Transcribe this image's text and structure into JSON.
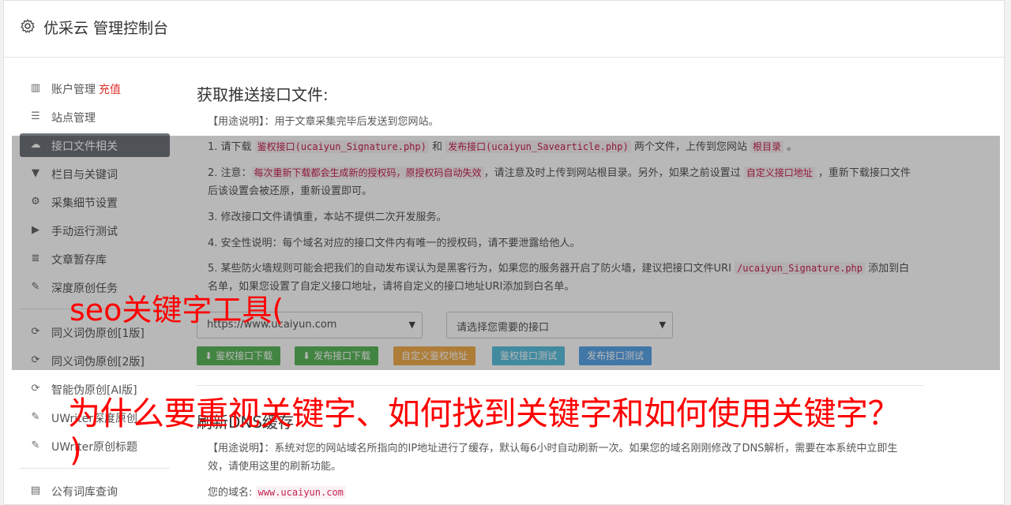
{
  "header": {
    "title": "优采云 管理控制台",
    "icon": "gear-icon"
  },
  "sidebar": {
    "items": [
      {
        "label": "账户管理",
        "extra": "充值",
        "icon": "bar-chart-icon",
        "glyph": "▥"
      },
      {
        "label": "站点管理",
        "icon": "server-icon",
        "glyph": "☰"
      },
      {
        "label": "接口文件相关",
        "icon": "cloud-upload-icon",
        "glyph": "☁",
        "active": true
      },
      {
        "label": "栏目与关键词",
        "icon": "filter-icon",
        "glyph": "▼"
      },
      {
        "label": "采集细节设置",
        "icon": "cogs-icon",
        "glyph": "⚙"
      },
      {
        "label": "手动运行测试",
        "icon": "play-circle-icon",
        "glyph": "▶"
      },
      {
        "label": "文章暂存库",
        "icon": "database-icon",
        "glyph": "≣"
      },
      {
        "label": "深度原创任务",
        "icon": "edit-icon",
        "glyph": "✎"
      },
      {
        "label": "同义词伪原创[1版]",
        "icon": "refresh-icon",
        "glyph": "⟳"
      },
      {
        "label": "同义词伪原创[2版]",
        "icon": "refresh-icon",
        "glyph": "⟳"
      },
      {
        "label": "智能伪原创[AI版]",
        "icon": "refresh-icon",
        "glyph": "⟳"
      },
      {
        "label": "UWriter深度原创",
        "icon": "edit-icon",
        "glyph": "✎"
      },
      {
        "label": "UWriter原创标题",
        "icon": "edit-icon",
        "glyph": "✎"
      },
      {
        "label": "公有词库查询",
        "icon": "book-icon",
        "glyph": "▤"
      }
    ]
  },
  "section1": {
    "title": "获取推送接口文件:",
    "usage": "【用途说明】：用于文章采集完毕后发送到您网站。",
    "p1": {
      "a": "1. 请下载 ",
      "c1": "鉴权接口(ucaiyun_Signature.php)",
      "b": " 和 ",
      "c2": "发布接口(ucaiyun_Savearticle.php)",
      "d": " 两个文件，上传到您网站 ",
      "c3": "根目录",
      "e": " 。"
    },
    "p2": {
      "a": "2. 注意：",
      "c1": "每次重新下载都会生成新的授权码，原授权码自动失效",
      "b": "，请注意及时上传到网站根目录。另外，如果之前设置过 ",
      "c2": "自定义接口地址",
      "d": " ，重新下载接口文件后该设置会被还原，重新设置即可。"
    },
    "p3": "3. 修改接口文件请慎重，本站不提供二次开发服务。",
    "p4": "4. 安全性说明：每个域名对应的接口文件内有唯一的授权码，请不要泄露给他人。",
    "p5": {
      "a": "5. 某些防火墙规则可能会把我们的自动发布误认为是黑客行为，如果您的服务器开启了防火墙，建议把接口文件URI ",
      "c1": "/ucaiyun_Signature.php",
      "b": " 添加到白名单，如果您设置了自定义接口地址，请将自定义的接口地址URI添加到白名单。"
    },
    "select_site": "https://www.ucaiyun.com",
    "select_api": "请选择您需要的接口",
    "buttons": {
      "download_auth": "鉴权接口下载",
      "download_publish": "发布接口下载",
      "custom_auth": "自定义鉴权地址",
      "test_auth": "鉴权接口测试",
      "test_publish": "发布接口测试"
    }
  },
  "section2": {
    "title": "刷新DNS缓存",
    "usage": "【用途说明】：系统对您的网站域名所指向的IP地址进行了缓存，默认每6小时自动刷新一次。如果您的域名刚刚修改了DNS解析，需要在本系统中立即生效，请使用这里的刷新功能。",
    "domain_label": "您的域名:",
    "domain_value": "www.ucaiyun.com"
  },
  "watermark": {
    "line1": "seo关键字工具(",
    "line2": "为什么要重视关键字、如何找到关键字和如何使用关键字？",
    "line3": ")"
  },
  "colors": {
    "active_bg": "#6e747a",
    "red": "#e0312b",
    "code": "#c7254e",
    "watermark": "#ff0000"
  }
}
